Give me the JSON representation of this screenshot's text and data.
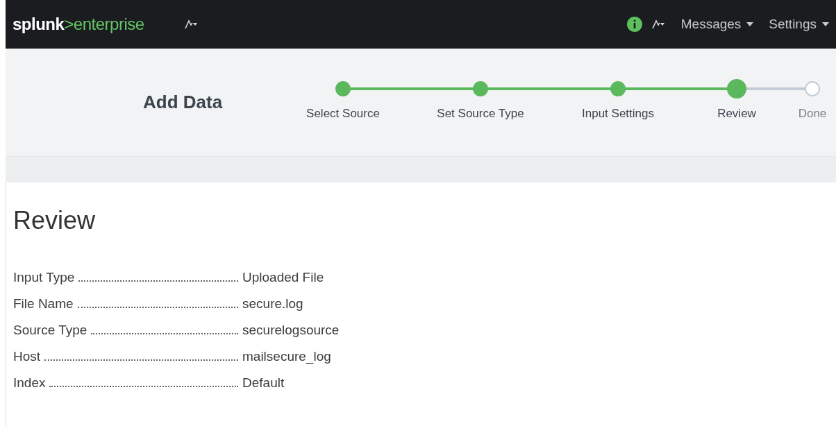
{
  "top_bar": {
    "logo": {
      "brand": "splunk",
      "product": ">enterprise"
    },
    "menus": [
      {
        "label": "Messages"
      },
      {
        "label": "Settings"
      }
    ]
  },
  "wizard": {
    "title": "Add Data",
    "steps": [
      {
        "label": "Select Source",
        "completed": true,
        "selected": false
      },
      {
        "label": "Set Source Type",
        "completed": true,
        "selected": false
      },
      {
        "label": "Input Settings",
        "completed": true,
        "selected": false
      },
      {
        "label": "Review",
        "completed": true,
        "selected": true
      },
      {
        "label": "Done",
        "completed": false,
        "selected": false
      }
    ]
  },
  "review": {
    "heading": "Review",
    "fields": [
      {
        "label": "Input Type",
        "value": "Uploaded File"
      },
      {
        "label": "File Name",
        "value": "secure.log"
      },
      {
        "label": "Source Type",
        "value": "securelogsource"
      },
      {
        "label": "Host",
        "value": "mailsecure_log"
      },
      {
        "label": "Index",
        "value": "Default"
      }
    ]
  }
}
